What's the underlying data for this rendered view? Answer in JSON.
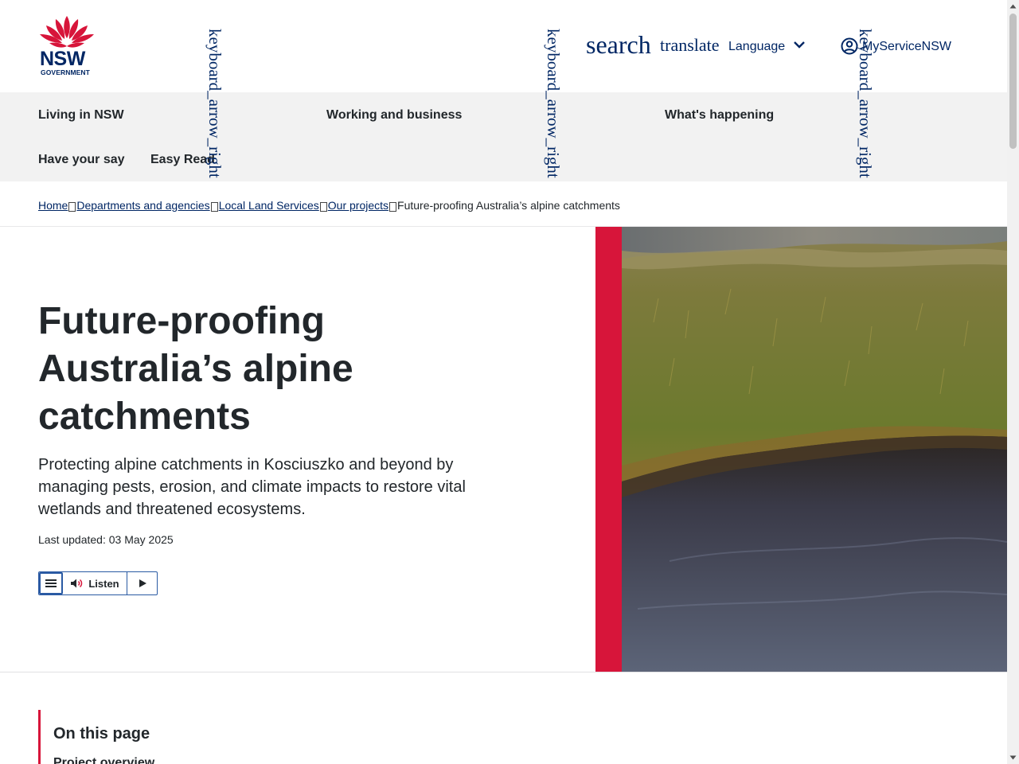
{
  "header": {
    "logo_text": "NSW",
    "logo_subtext": "GOVERNMENT",
    "search_icon_text": "search",
    "translate_icon_text": "translate",
    "language_label": "Language",
    "account_label": "MyServiceNSW",
    "arrow_icon_text": "keyboard_arrow_right"
  },
  "nav": {
    "items": [
      {
        "label": "Living in NSW"
      },
      {
        "label": "Working and business"
      },
      {
        "label": "What's happening"
      },
      {
        "label": "Have your say"
      },
      {
        "label": "Easy Read"
      }
    ]
  },
  "breadcrumb": {
    "items": [
      {
        "label": "Home"
      },
      {
        "label": "Departments and agencies"
      },
      {
        "label": "Local Land Services"
      },
      {
        "label": "Our projects"
      }
    ],
    "current": "Future-proofing Australia’s alpine catchments"
  },
  "hero": {
    "title": "Future-proofing Australia’s alpine catchments",
    "description": "Protecting alpine catchments in Kosciuszko and beyond by managing pests, erosion, and climate impacts to restore vital wetlands and threatened ecosystems.",
    "last_updated": "Last updated: 03 May 2025",
    "listen_label": "Listen"
  },
  "on_this_page": {
    "title": "On this page",
    "first_link": "Project overview"
  },
  "colors": {
    "brand_navy": "#002664",
    "brand_red": "#d7153a",
    "nav_bg": "#f2f2f2",
    "text": "#22272b"
  }
}
